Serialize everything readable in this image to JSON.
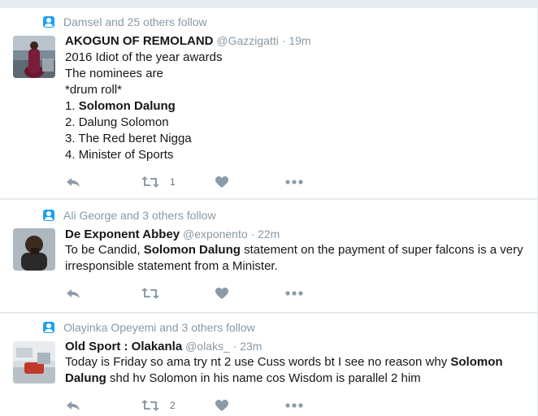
{
  "tweets": [
    {
      "context": "Damsel and 25 others follow",
      "name": "AKOGUN OF REMOLAND",
      "handle": "@Gazzigatti",
      "time": "19m",
      "lines": [
        "2016 Idiot of the year awards",
        "The nominees are",
        "*drum roll*"
      ],
      "list": [
        {
          "num": "1. ",
          "text": "Solomon Dalung"
        },
        {
          "num": "2. ",
          "text": "Dalung Solomon"
        },
        {
          "num": "3. ",
          "text": "The Red beret Nigga"
        },
        {
          "num": "4. ",
          "text": "Minister of Sports"
        }
      ],
      "retweet_count": "1"
    },
    {
      "context": "Ali George and 3 others follow",
      "name": "De Exponent Abbey",
      "handle": "@exponento",
      "time": "22m",
      "text_before": "To be Candid, ",
      "text_bold": "Solomon Dalung",
      "text_after": " statement on the payment of super falcons is a very irresponsible statement from a Minister.",
      "retweet_count": ""
    },
    {
      "context": "Olayinka Opeyemi and 3 others follow",
      "name": "Old Sport : Olakanla",
      "handle": "@olaks_",
      "time": "23m",
      "text_before": "Today is Friday so ama try nt 2 use Cuss words bt I see no reason why ",
      "text_bold": "Solomon Dalung",
      "text_after": " shd hv Solomon in his name cos Wisdom is parallel 2 him",
      "retweet_count": "2"
    }
  ],
  "colors": {
    "link": "#1da1f2",
    "meta": "#8899a6",
    "action": "#8b9ca9"
  },
  "icons": [
    "person-icon",
    "reply-icon",
    "retweet-icon",
    "like-icon",
    "more-icon"
  ],
  "separator": "·"
}
